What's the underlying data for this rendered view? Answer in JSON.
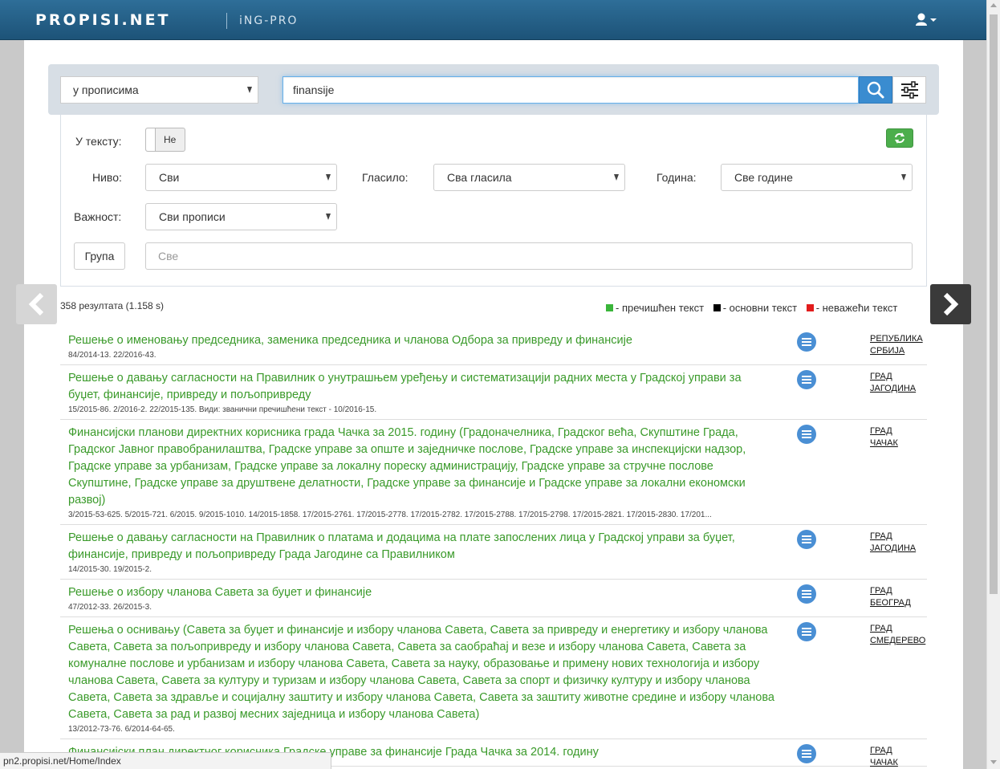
{
  "header": {
    "logo": "PROPISI.NET",
    "logo_secondary": "iNG-PRO"
  },
  "search": {
    "scope": "у прописима",
    "query": "finansije"
  },
  "filters": {
    "in_text_label": "У тексту:",
    "in_text_value": "Не",
    "level_label": "Ниво:",
    "level_value": "Сви",
    "gazette_label": "Гласило:",
    "gazette_value": "Сва гласила",
    "year_label": "Година:",
    "year_value": "Све године",
    "importance_label": "Важност:",
    "importance_value": "Сви прописи",
    "group_button": "Група",
    "group_placeholder": "Све"
  },
  "results": {
    "count": "358 резултата (1.158 s)",
    "legend": [
      {
        "label": "- пречишћен текст",
        "color": "#3ab53a"
      },
      {
        "label": "- основни текст",
        "color": "#000000"
      },
      {
        "label": "- неважећи текст",
        "color": "#e21c1c"
      }
    ],
    "items": [
      {
        "title": "Решење о именовању председника, заменика председника и чланова Одбора за привреду и финансије",
        "refs": "84/2014-13. 22/2016-43.",
        "loc1": "РЕПУБЛИКА",
        "loc2": "СРБИЈА"
      },
      {
        "title": "Решење о давању сагласности на Правилник о унутрашњем уређењу и систематизацији радних места у Градској управи за буџет, финансије, привреду и пољопривреду",
        "refs": "15/2015-86. 2/2016-2. 22/2015-135. Види: званични пречишћени текст - 10/2016-15.",
        "loc1": "ГРАД",
        "loc2": "ЈАГОДИНА"
      },
      {
        "title": "Финансијски планови директних корисника града Чачка за 2015. годину (Градоначелника, Градског већа, Скупштине Града, Градског Јавног правобранилаштва, Градске управе за опште и заједничке послове, Градске управе за инспекцијски надзор, Градске управе за урбанизам, Градске управе за локалну пореску администрацију, Градске управе за стручне послове Скупштине, Градске управе за друштвене делатности, Градске управе за финансије и Градске управе за локални економски развој)",
        "refs": "3/2015-53-625. 5/2015-721. 6/2015. 9/2015-1010. 14/2015-1858. 17/2015-2761. 17/2015-2778. 17/2015-2782. 17/2015-2788. 17/2015-2798. 17/2015-2821. 17/2015-2830. 17/201...",
        "loc1": "ГРАД",
        "loc2": "ЧАЧАК"
      },
      {
        "title": "Решење о давању сагласности на Правилник о платама и додацима на плате запослених лица у Градској управи за буџет, финансије, привреду и пољопривреду Града Јагодине са Правилником",
        "refs": "14/2015-30. 19/2015-2.",
        "loc1": "ГРАД",
        "loc2": "ЈАГОДИНА"
      },
      {
        "title": "Решење о избору чланова Савета за буџет и финансије",
        "refs": "47/2012-33. 26/2015-3.",
        "loc1": "ГРАД",
        "loc2": "БЕОГРАД"
      },
      {
        "title": "Решења о оснивању (Савета за буџет и финансије и избору чланова Савета, Савета за привреду и енергетику и избору чланова Савета, Савета за пољопривреду и избору чланова Савета, Савета за саобраћај и везе и избору чланова Савета, Савета за комуналне послове и урбанизам и избору чланова Савета, Савета за науку, образовање и примену нових технологија и избору чланова Савета, Савета за културу и туризам и избору чланова Савета, Савета за спорт и физичку културу и избору чланова Савета, Савета за здравље и социјалну заштиту и избору чланова Савета, Савета за заштиту животне средине и избору чланова Савета, Савета за рад и развој месних заједница и избору чланова Савета)",
        "refs": "13/2012-73-76. 6/2014-64-65.",
        "loc1": "ГРАД",
        "loc2": "СМЕДЕРЕВО"
      },
      {
        "title": "Финансијски план директног корисника Градске управе за финансије Града Чачка за 2014. годину",
        "refs": "",
        "loc1": "ГРАД",
        "loc2": "ЧАЧАК"
      }
    ]
  },
  "status_bar": "pn2.propisi.net/Home/Index"
}
